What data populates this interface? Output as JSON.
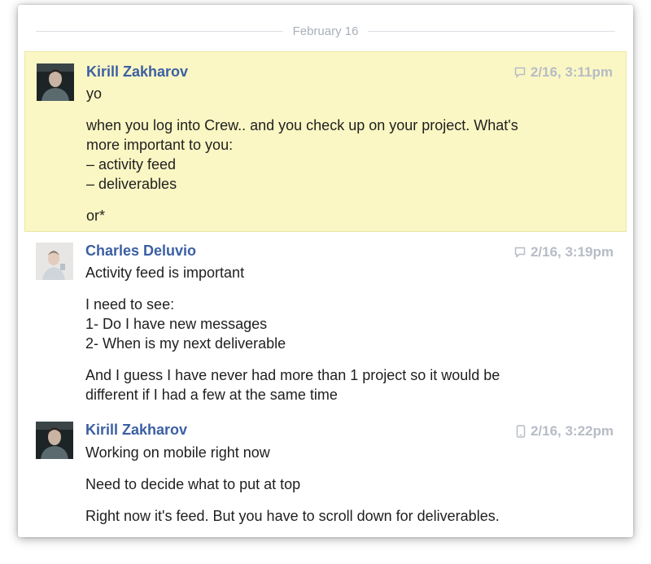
{
  "date_divider": "February 16",
  "colors": {
    "highlight_bg": "#fbf7c4",
    "author": "#3b5fa3",
    "timestamp": "#b7bcc6"
  },
  "messages": [
    {
      "author": "Kirill Zakharov",
      "timestamp": "2/16, 3:11pm",
      "source_icon": "chat-bubble-icon",
      "highlighted": true,
      "lines": [
        "yo",
        "when you log into Crew.. and you check up on your project. What's",
        "more important to you:",
        "– activity feed",
        "– deliverables",
        "or*"
      ]
    },
    {
      "author": "Charles Deluvio",
      "timestamp": "2/16, 3:19pm",
      "source_icon": "chat-bubble-icon",
      "highlighted": false,
      "lines": [
        "Activity feed is important",
        "I need to see:",
        "1- Do I have new messages",
        "2- When is my next deliverable",
        "And I guess I have never had more than 1 project so it would be",
        "different if I had a few at the same time"
      ]
    },
    {
      "author": "Kirill Zakharov",
      "timestamp": "2/16, 3:22pm",
      "source_icon": "mobile-phone-icon",
      "highlighted": false,
      "lines": [
        "Working on mobile right now",
        "Need to decide what to put at top",
        "Right now it's feed. But you have to scroll down for deliverables."
      ]
    }
  ]
}
